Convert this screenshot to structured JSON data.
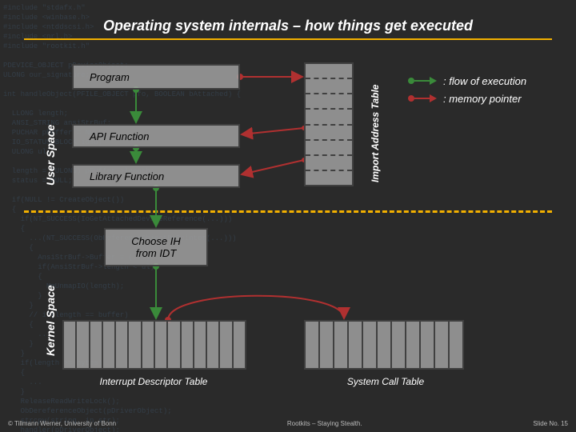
{
  "code_bg": "#include \"stdafx.h\"\n#include <winbase.h>\n#include <ntddscsi.h>\n#include <nrl.h>\n#include \"rootkit.h\"\n\nPDEVICE_OBJECT pDeviceObject;\nULONG our_signature;\n\nint handleObject(PFILE_OBJECT pfo, BOOLEAN bAttached) {\n\n  LLONG length;\n  ANSI_STRING ansiStrBuf;\n  PUCHAR pBuffer = NULL;\n  IO_STATUS_BLOCK iosb;\n  ULONG ul;\n\n  length = (ULONG) pBuffer->length;\n  status = NULL;\n\n  if(NULL != CreateObject()) \n  {\n    if(NT_SUCCESS(IoGetAttachedDeviceReference(...)))\n    {\n      ...(NT_SUCCESS(ObReferenceObjectByPointer(...)))\n      {\n        AnsiStrBuf->Buffer = (...);\n        if(AnsiStrBuf->length < ul)\n        {\n          MmUnmapIO(length);\n        }\n      }\n      // if(length == buffer) \n      {\n        ... \n      } \n    }\n    if(length >= bytes)\n    {\n      ...\n    }\n    ReleaseReadWriteLock();\n    ObDereferenceObject(pDriverObject);\n    strcpy(string, in_str);\n    handler(pDriverObject);\n    if(buf) \n    {\n      ...\n    }\n  }\n}",
  "title": "Operating system internals – how things get executed",
  "boxes": {
    "program": "Program",
    "api": "API Function",
    "library": "Library Function",
    "choose": "Choose IH\nfrom IDT"
  },
  "vlabels": {
    "user": "User Space",
    "kernel": "Kernel Space",
    "iat": "Import Address Table"
  },
  "tables": {
    "idt_label": "Interrupt Descriptor Table",
    "sct_label": "System Call Table"
  },
  "legend": {
    "flow": ": flow of execution",
    "mem": ": memory pointer"
  },
  "footer": {
    "left": "© Tillmann Werner, University of Bonn",
    "center": "Rootkits – Staying Stealth.",
    "right": "Slide No. 15"
  },
  "chart_data": {
    "type": "diagram",
    "title": "Operating system internals – how things get executed",
    "regions": [
      "User Space",
      "Kernel Space"
    ],
    "nodes": [
      {
        "id": "program",
        "label": "Program",
        "region": "User Space"
      },
      {
        "id": "api",
        "label": "API Function",
        "region": "User Space"
      },
      {
        "id": "library",
        "label": "Library Function",
        "region": "User Space"
      },
      {
        "id": "iat",
        "label": "Import Address Table",
        "region": "User Space",
        "shape": "table-vertical"
      },
      {
        "id": "choose",
        "label": "Choose IH from IDT",
        "region": "Kernel Space"
      },
      {
        "id": "idt",
        "label": "Interrupt Descriptor Table",
        "region": "Kernel Space",
        "shape": "table"
      },
      {
        "id": "sct",
        "label": "System Call Table",
        "region": "Kernel Space",
        "shape": "table"
      }
    ],
    "edges": [
      {
        "from": "program",
        "to": "api",
        "type": "flow"
      },
      {
        "from": "api",
        "to": "library",
        "type": "flow"
      },
      {
        "from": "library",
        "to": "choose",
        "type": "flow",
        "crosses_boundary": true
      },
      {
        "from": "choose",
        "to": "idt",
        "type": "flow"
      },
      {
        "from": "program",
        "to": "iat",
        "type": "pointer"
      },
      {
        "from": "iat",
        "to": "api",
        "type": "pointer"
      },
      {
        "from": "iat",
        "to": "library",
        "type": "pointer"
      },
      {
        "from": "idt",
        "to": "sct",
        "type": "pointer"
      }
    ],
    "legend": {
      "flow": "flow of execution (green arrow)",
      "pointer": "memory pointer (red arrow)"
    }
  }
}
